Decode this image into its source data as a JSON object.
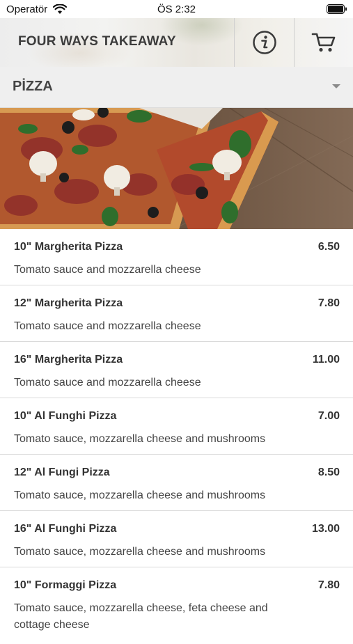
{
  "status_bar": {
    "carrier": "Operatör",
    "time": "ÖS 2:32"
  },
  "header": {
    "title": "FOUR WAYS TAKEAWAY",
    "info_icon": "info-icon",
    "cart_icon": "cart-icon"
  },
  "category": {
    "label": "PİZZA"
  },
  "menu": {
    "items": [
      {
        "name": "10\" Margherita Pizza",
        "price": "6.50",
        "description": "Tomato sauce and mozzarella cheese"
      },
      {
        "name": "12\" Margherita Pizza",
        "price": "7.80",
        "description": "Tomato sauce and mozzarella cheese"
      },
      {
        "name": "16\" Margherita Pizza",
        "price": "11.00",
        "description": "Tomato sauce and mozzarella cheese"
      },
      {
        "name": "10\" Al Funghi Pizza",
        "price": "7.00",
        "description": "Tomato sauce, mozzarella cheese and mushrooms"
      },
      {
        "name": "12\" Al Fungi Pizza",
        "price": "8.50",
        "description": "Tomato sauce, mozzarella cheese and mushrooms"
      },
      {
        "name": "16\" Al Funghi Pizza",
        "price": "13.00",
        "description": "Tomato sauce, mozzarella cheese and mushrooms"
      },
      {
        "name": "10\" Formaggi Pizza",
        "price": "7.80",
        "description": "Tomato sauce, mozzarella cheese, feta cheese and cottage cheese"
      }
    ]
  }
}
